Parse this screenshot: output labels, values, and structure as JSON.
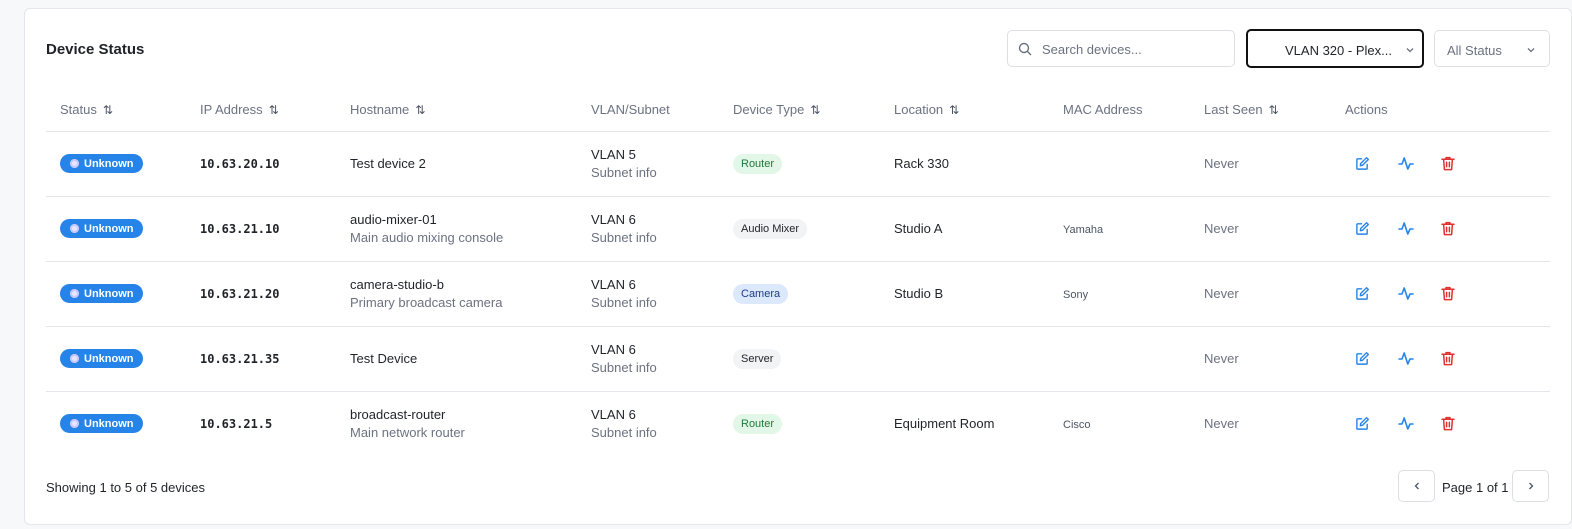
{
  "header": {
    "title": "Device Status"
  },
  "search": {
    "placeholder": "Search devices..."
  },
  "filters": {
    "vlan_value": "VLAN 320 - Plex...",
    "status_value": "All Status"
  },
  "table": {
    "columns": [
      "Status",
      "IP Address",
      "Hostname",
      "VLAN/Subnet",
      "Device Type",
      "Location",
      "MAC Address",
      "Last Seen",
      "Actions"
    ],
    "rows": [
      {
        "status": "Unknown",
        "ip": "10.63.20.10",
        "hostname": "Test device 2",
        "description": "",
        "vlan": "VLAN 5",
        "subnet": "Subnet info",
        "type": "Router",
        "location": "Rack 330",
        "mac": "",
        "last_seen": "Never"
      },
      {
        "status": "Unknown",
        "ip": "10.63.21.10",
        "hostname": "audio-mixer-01",
        "description": "Main audio mixing console",
        "vlan": "VLAN 6",
        "subnet": "Subnet info",
        "type": "Audio Mixer",
        "location": "Studio A",
        "mac": "Yamaha",
        "last_seen": "Never"
      },
      {
        "status": "Unknown",
        "ip": "10.63.21.20",
        "hostname": "camera-studio-b",
        "description": "Primary broadcast camera",
        "vlan": "VLAN 6",
        "subnet": "Subnet info",
        "type": "Camera",
        "location": "Studio B",
        "mac": "Sony",
        "last_seen": "Never"
      },
      {
        "status": "Unknown",
        "ip": "10.63.21.35",
        "hostname": "Test Device",
        "description": "",
        "vlan": "VLAN 6",
        "subnet": "Subnet info",
        "type": "Server",
        "location": "",
        "mac": "",
        "last_seen": "Never"
      },
      {
        "status": "Unknown",
        "ip": "10.63.21.5",
        "hostname": "broadcast-router",
        "description": "Main network router",
        "vlan": "VLAN 6",
        "subnet": "Subnet info",
        "type": "Router",
        "location": "Equipment Room",
        "mac": "Cisco",
        "last_seen": "Never"
      }
    ]
  },
  "footer": {
    "showing": "Showing 1 to 5 of 5 devices",
    "page": "Page 1 of 1"
  },
  "icons": {
    "search": "search-icon",
    "chevron": "chevron-down-icon",
    "sort": "sort-icon",
    "edit": "edit-icon",
    "activity": "activity-icon",
    "delete": "trash-icon",
    "prev": "chevron-left-icon",
    "next": "chevron-right-icon"
  },
  "colors": {
    "status_unknown": "#2684e8",
    "edit": "#2684e8",
    "activity": "#2684e8",
    "delete": "#e03131",
    "type_styles": {
      "Router": {
        "bg": "#e3f7e8",
        "fg": "#1f7a3a"
      },
      "Audio Mixer": {
        "bg": "#f1f3f5",
        "fg": "#1f2328"
      },
      "Camera": {
        "bg": "#dce8fb",
        "fg": "#1c3d8a"
      },
      "Server": {
        "bg": "#f1f3f5",
        "fg": "#1f2328"
      }
    }
  }
}
